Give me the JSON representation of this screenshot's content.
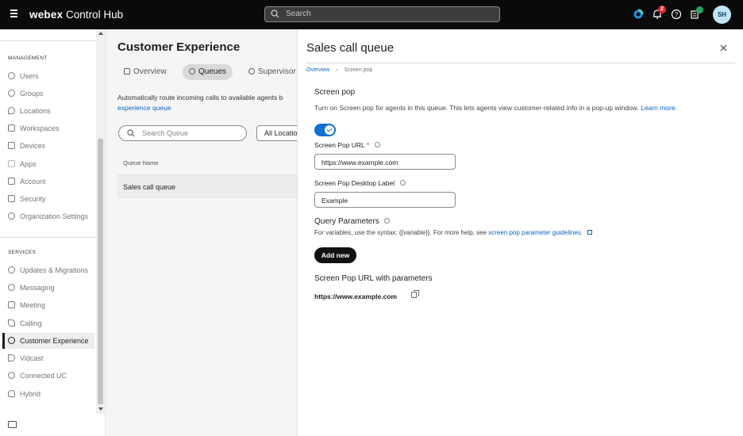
{
  "topbar": {
    "brand": "webex",
    "product": "Control Hub",
    "search_placeholder": "Search",
    "notification_count": "2",
    "avatar_initials": "SH"
  },
  "sidebar": {
    "management_heading": "MANAGEMENT",
    "management_items": [
      {
        "label": "Users",
        "icon": "user-icon"
      },
      {
        "label": "Groups",
        "icon": "groups-icon"
      },
      {
        "label": "Locations",
        "icon": "location-icon"
      },
      {
        "label": "Workspaces",
        "icon": "workspace-icon"
      },
      {
        "label": "Devices",
        "icon": "device-icon"
      },
      {
        "label": "Apps",
        "icon": "apps-icon"
      },
      {
        "label": "Account",
        "icon": "account-icon"
      },
      {
        "label": "Security",
        "icon": "lock-icon"
      },
      {
        "label": "Organization Settings",
        "icon": "gear-icon"
      }
    ],
    "services_heading": "SERVICES",
    "services_items": [
      {
        "label": "Updates & Migrations",
        "icon": "refresh-icon"
      },
      {
        "label": "Messaging",
        "icon": "message-icon"
      },
      {
        "label": "Meeting",
        "icon": "calendar-icon"
      },
      {
        "label": "Calling",
        "icon": "phone-icon"
      },
      {
        "label": "Customer Experience",
        "icon": "customer-experience-icon"
      },
      {
        "label": "Vidcast",
        "icon": "play-icon"
      },
      {
        "label": "Connected UC",
        "icon": "connected-icon"
      },
      {
        "label": "Hybrid",
        "icon": "cloud-icon"
      }
    ]
  },
  "main": {
    "title": "Customer Experience",
    "tabs": [
      "Overview",
      "Queues",
      "Supervisor"
    ],
    "desc_text": "Automatically route incoming calls to available agents b",
    "desc_link": "experience queue",
    "search_placeholder": "Search Queue",
    "filter_value": "All Locations",
    "column_header": "Queue Name",
    "rows": [
      "Sales call queue"
    ]
  },
  "drawer": {
    "title": "Sales call queue",
    "breadcrumb_root": "Overview",
    "breadcrumb_current": "Screen pop",
    "section_title": "Screen pop",
    "section_desc": "Turn on Screen pop for agents in this queue. This lets agents view customer-related info in a pop-up window.",
    "learn_more": "Learn more.",
    "toggle_on": true,
    "url_label": "Screen Pop URL",
    "url_required": "*",
    "url_value": "https://www.example.com",
    "desktop_label_label": "Screen Pop Desktop Label",
    "desktop_label_value": "Example",
    "query_title": "Query Parameters",
    "query_desc": "For variables, use the syntax: {{variable}}. For more help, see",
    "query_link": "screen pop parameter guidelines.",
    "add_new": "Add new",
    "url_params_title": "Screen Pop URL with parameters",
    "url_params_value": "https://www.example.com"
  },
  "colors": {
    "accent": "#1170cf",
    "link": "#0a66c2",
    "badge": "#e3262f",
    "topbar": "#0a0a0a"
  }
}
